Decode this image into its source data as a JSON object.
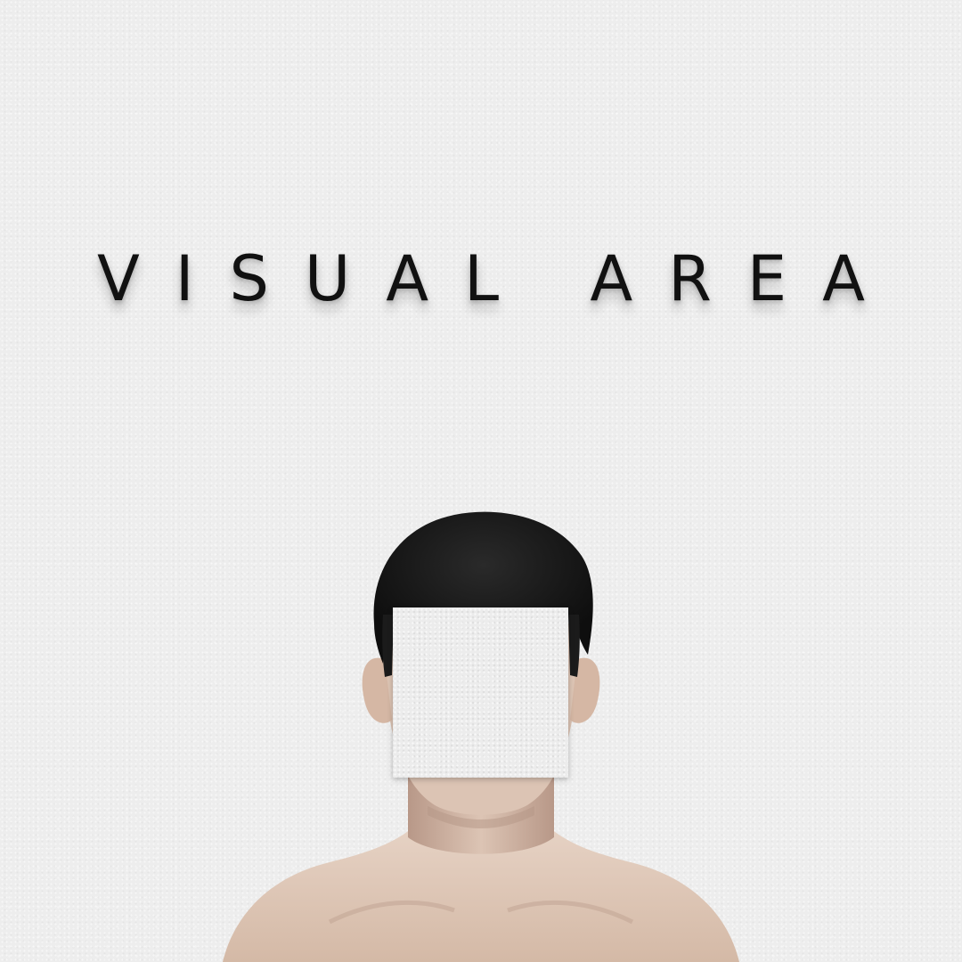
{
  "title": {
    "text": "VISUAL AREA",
    "color": "#111111"
  },
  "background": {
    "color": "#ededed"
  },
  "figure": {
    "skin_color": "#dcc4b4",
    "hair_color": "#141414",
    "face_block_color": "#ececec"
  }
}
